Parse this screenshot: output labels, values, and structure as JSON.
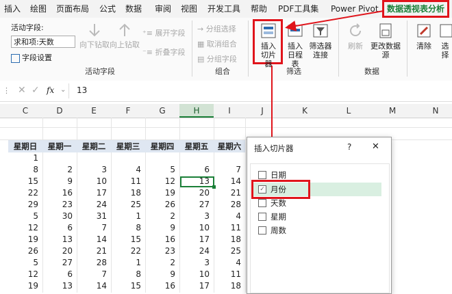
{
  "menu": {
    "tabs": [
      "插入",
      "绘图",
      "页面布局",
      "公式",
      "数据",
      "审阅",
      "视图",
      "开发工具",
      "帮助",
      "PDF工具集",
      "Power Pivot",
      "数据透视表分析"
    ]
  },
  "ribbon": {
    "active_field_label": "活动字段:",
    "active_field_value": "求和项:天数",
    "field_settings": "字段设置",
    "drill_down": "向下钻取",
    "drill_up": "向上钻取",
    "expand_field": "展开字段",
    "collapse_field": "折叠字段",
    "group_active_field": "活动字段",
    "group_selection": "分组选择",
    "ungroup": "取消组合",
    "group_field": "分组字段",
    "group_group": "组合",
    "insert_slicer": "插入切片器",
    "insert_timeline": "插入日程表",
    "filter_connections": "筛选器连接",
    "group_filter": "筛选",
    "refresh": "刷新",
    "change_source": "更改数据源",
    "group_data": "数据",
    "clear": "清除",
    "select": "选择"
  },
  "formula_bar": {
    "fx": "fx",
    "value": "13"
  },
  "columns": [
    "C",
    "D",
    "E",
    "F",
    "G",
    "H",
    "I",
    "J",
    "K",
    "L",
    "M",
    "N"
  ],
  "weekday_headers": [
    "星期日",
    "星期一",
    "星期二",
    "星期三",
    "星期四",
    "星期五",
    "星期六"
  ],
  "rows": [
    [
      "1",
      "",
      "",
      "",
      "",
      "",
      ""
    ],
    [
      "8",
      "2",
      "3",
      "4",
      "5",
      "6",
      "7"
    ],
    [
      "15",
      "9",
      "10",
      "11",
      "12",
      "13",
      "14"
    ],
    [
      "22",
      "16",
      "17",
      "18",
      "19",
      "20",
      "21"
    ],
    [
      "29",
      "23",
      "24",
      "25",
      "26",
      "27",
      "28"
    ],
    [
      "5",
      "30",
      "31",
      "1",
      "2",
      "3",
      "4"
    ],
    [
      "12",
      "6",
      "7",
      "8",
      "9",
      "10",
      "11"
    ],
    [
      "19",
      "13",
      "14",
      "15",
      "16",
      "17",
      "18"
    ],
    [
      "26",
      "20",
      "21",
      "22",
      "23",
      "24",
      "25"
    ],
    [
      "5",
      "27",
      "28",
      "1",
      "2",
      "3",
      "4"
    ],
    [
      "12",
      "6",
      "7",
      "8",
      "9",
      "10",
      "11"
    ],
    [
      "19",
      "13",
      "14",
      "15",
      "16",
      "17",
      "18"
    ]
  ],
  "dialog": {
    "title": "插入切片器",
    "help": "?",
    "close": "✕",
    "fields": [
      {
        "label": "日期",
        "checked": false
      },
      {
        "label": "月份",
        "checked": true
      },
      {
        "label": "天数",
        "checked": false
      },
      {
        "label": "星期",
        "checked": false
      },
      {
        "label": "周数",
        "checked": false
      }
    ]
  },
  "colors": {
    "accent_green": "#1a7f37",
    "highlight_red": "#e0141b"
  }
}
